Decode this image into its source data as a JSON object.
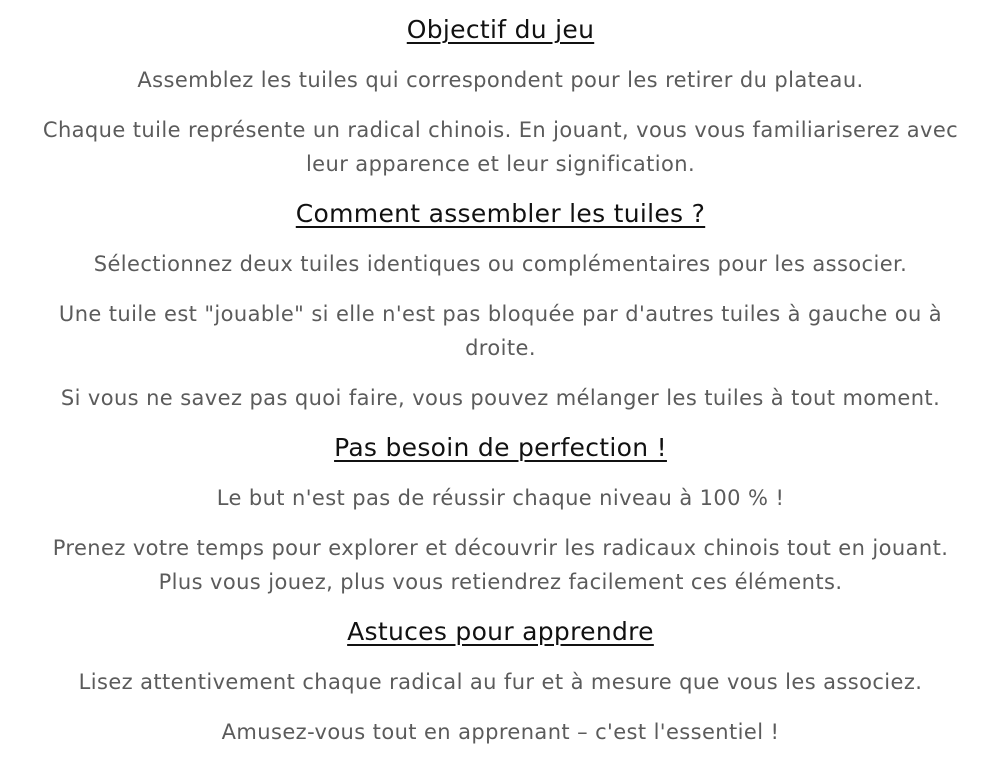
{
  "sections": [
    {
      "title": "Objectif du jeu",
      "paragraphs": [
        "Assemblez les tuiles qui correspondent pour les retirer du plateau.",
        "Chaque tuile représente un radical chinois. En jouant, vous vous familiariserez avec leur apparence et leur signification."
      ]
    },
    {
      "title": "Comment assembler les tuiles ?",
      "paragraphs": [
        "Sélectionnez deux tuiles identiques ou complémentaires pour les associer.",
        "Une tuile est \"jouable\" si elle n'est pas bloquée par d'autres tuiles à gauche ou à droite.",
        "Si vous ne savez pas quoi faire, vous pouvez mélanger les tuiles à tout moment."
      ]
    },
    {
      "title": "Pas besoin de perfection !",
      "paragraphs": [
        "Le but n'est pas de réussir chaque niveau à 100 % !",
        "Prenez votre temps pour explorer et découvrir les radicaux chinois tout en jouant. Plus vous jouez, plus vous retiendrez facilement ces éléments."
      ]
    },
    {
      "title": "Astuces pour apprendre",
      "paragraphs": [
        "Lisez attentivement chaque radical au fur et à mesure que vous les associez.",
        "Amusez-vous tout en apprenant – c'est l'essentiel !"
      ]
    }
  ]
}
